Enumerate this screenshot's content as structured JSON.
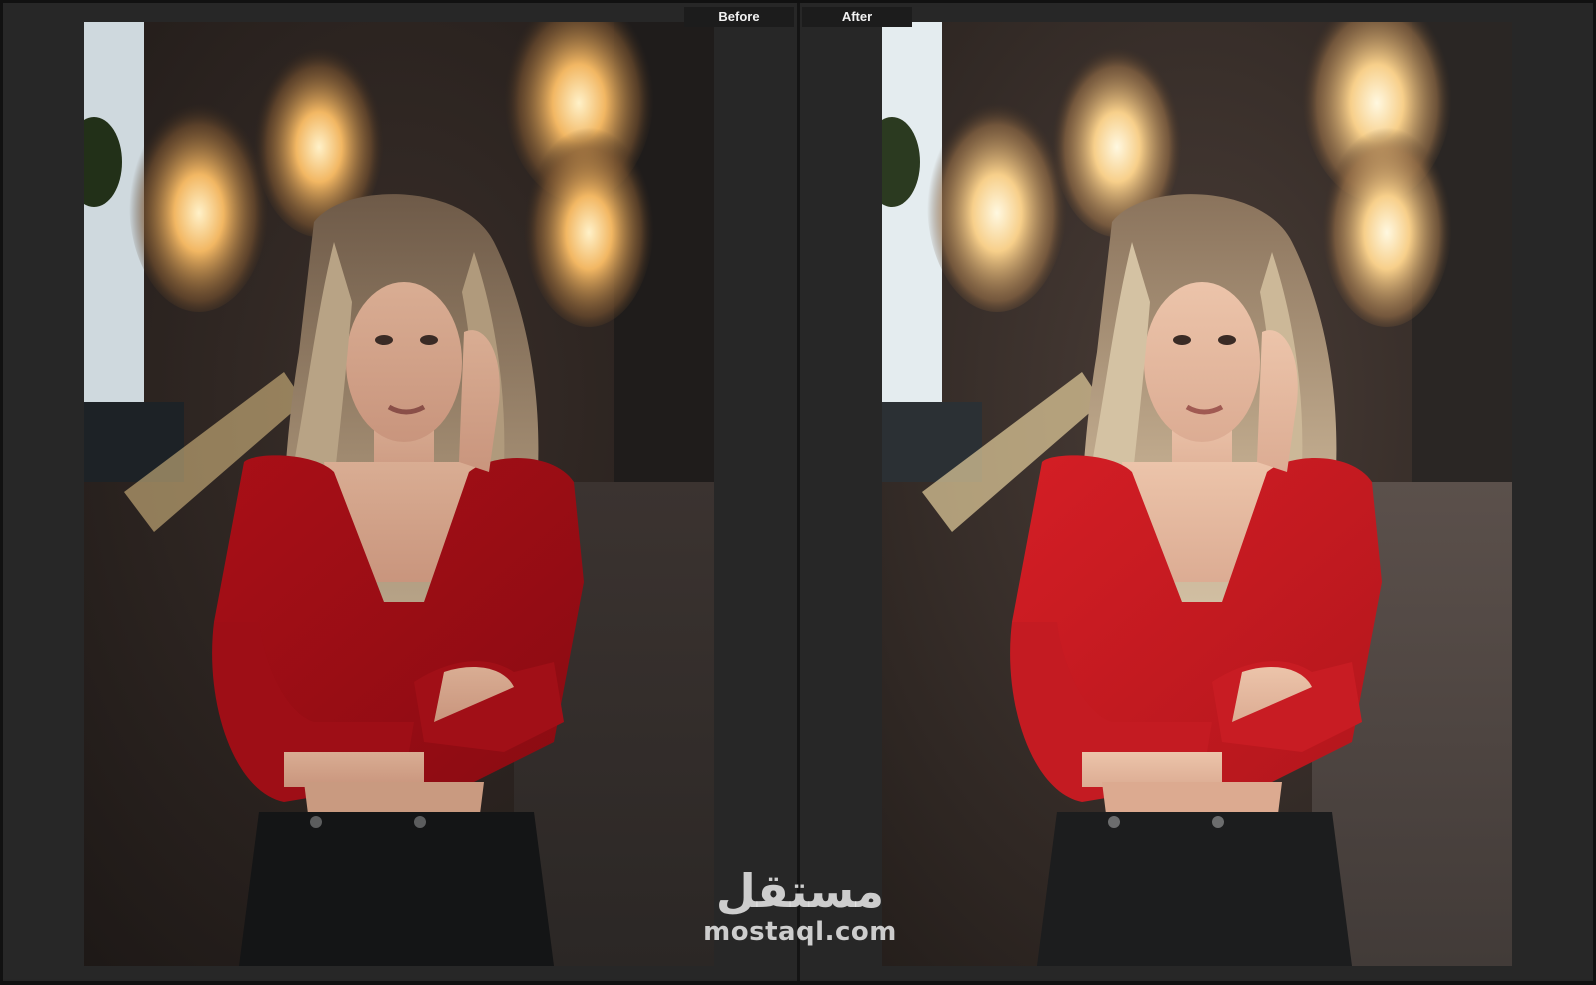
{
  "comparison": {
    "before_label": "Before",
    "after_label": "After"
  },
  "watermark": {
    "arabic": "مستقل",
    "latin": "mostaql.com"
  },
  "colors": {
    "background": "#262626",
    "tab": "#1c1c1c",
    "shirt_before": "#b3121a",
    "shirt_after": "#cc1c22",
    "bulb_glow": "#ffd38a"
  }
}
